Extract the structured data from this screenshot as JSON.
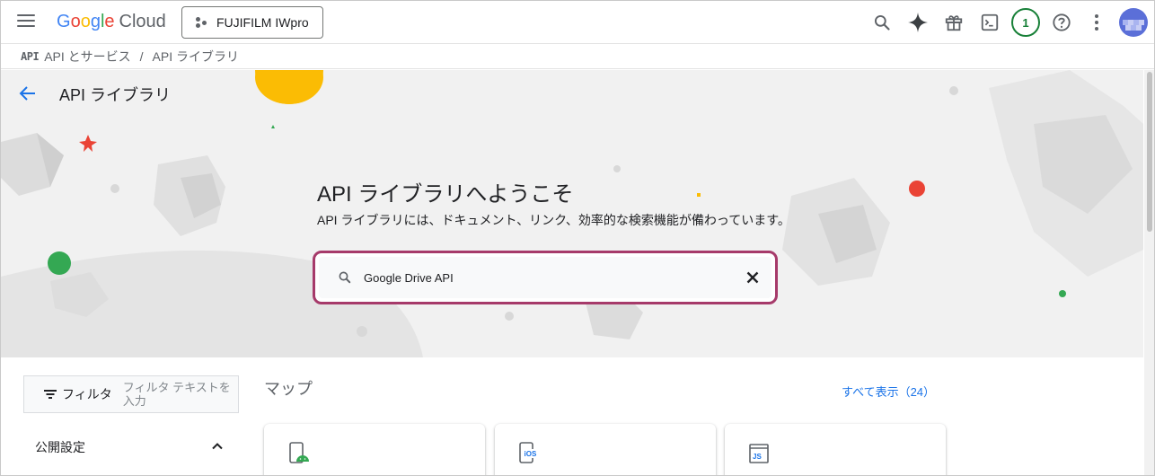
{
  "header": {
    "logo_google": "Google",
    "logo_cloud": "Cloud",
    "project_name": "FUJIFILM IWpro",
    "notification_count": "1"
  },
  "breadcrumb": {
    "badge": "API",
    "item1": "API とサービス",
    "separator": "/",
    "item2": "API ライブラリ"
  },
  "hero": {
    "page_title": "API ライブラリ",
    "welcome_title": "API ライブラリへようこそ",
    "welcome_subtitle": "API ライブラリには、ドキュメント、リンク、効率的な検索機能が備わっています。",
    "search_value": "Google Drive API"
  },
  "sidebar": {
    "filter_label": "フィルタ",
    "filter_placeholder": "フィルタ テキストを入力",
    "section_public": "公開設定"
  },
  "main": {
    "section_title": "マップ",
    "show_all": "すべて表示（24）",
    "cards": [
      {
        "icon": "android-maps-icon"
      },
      {
        "icon": "ios-maps-icon",
        "label": "iOS"
      },
      {
        "icon": "js-maps-icon",
        "label": "JS"
      }
    ]
  },
  "colors": {
    "search_highlight": "#a63a6a",
    "accent_blue": "#1a73e8",
    "notification_green": "#188038"
  }
}
